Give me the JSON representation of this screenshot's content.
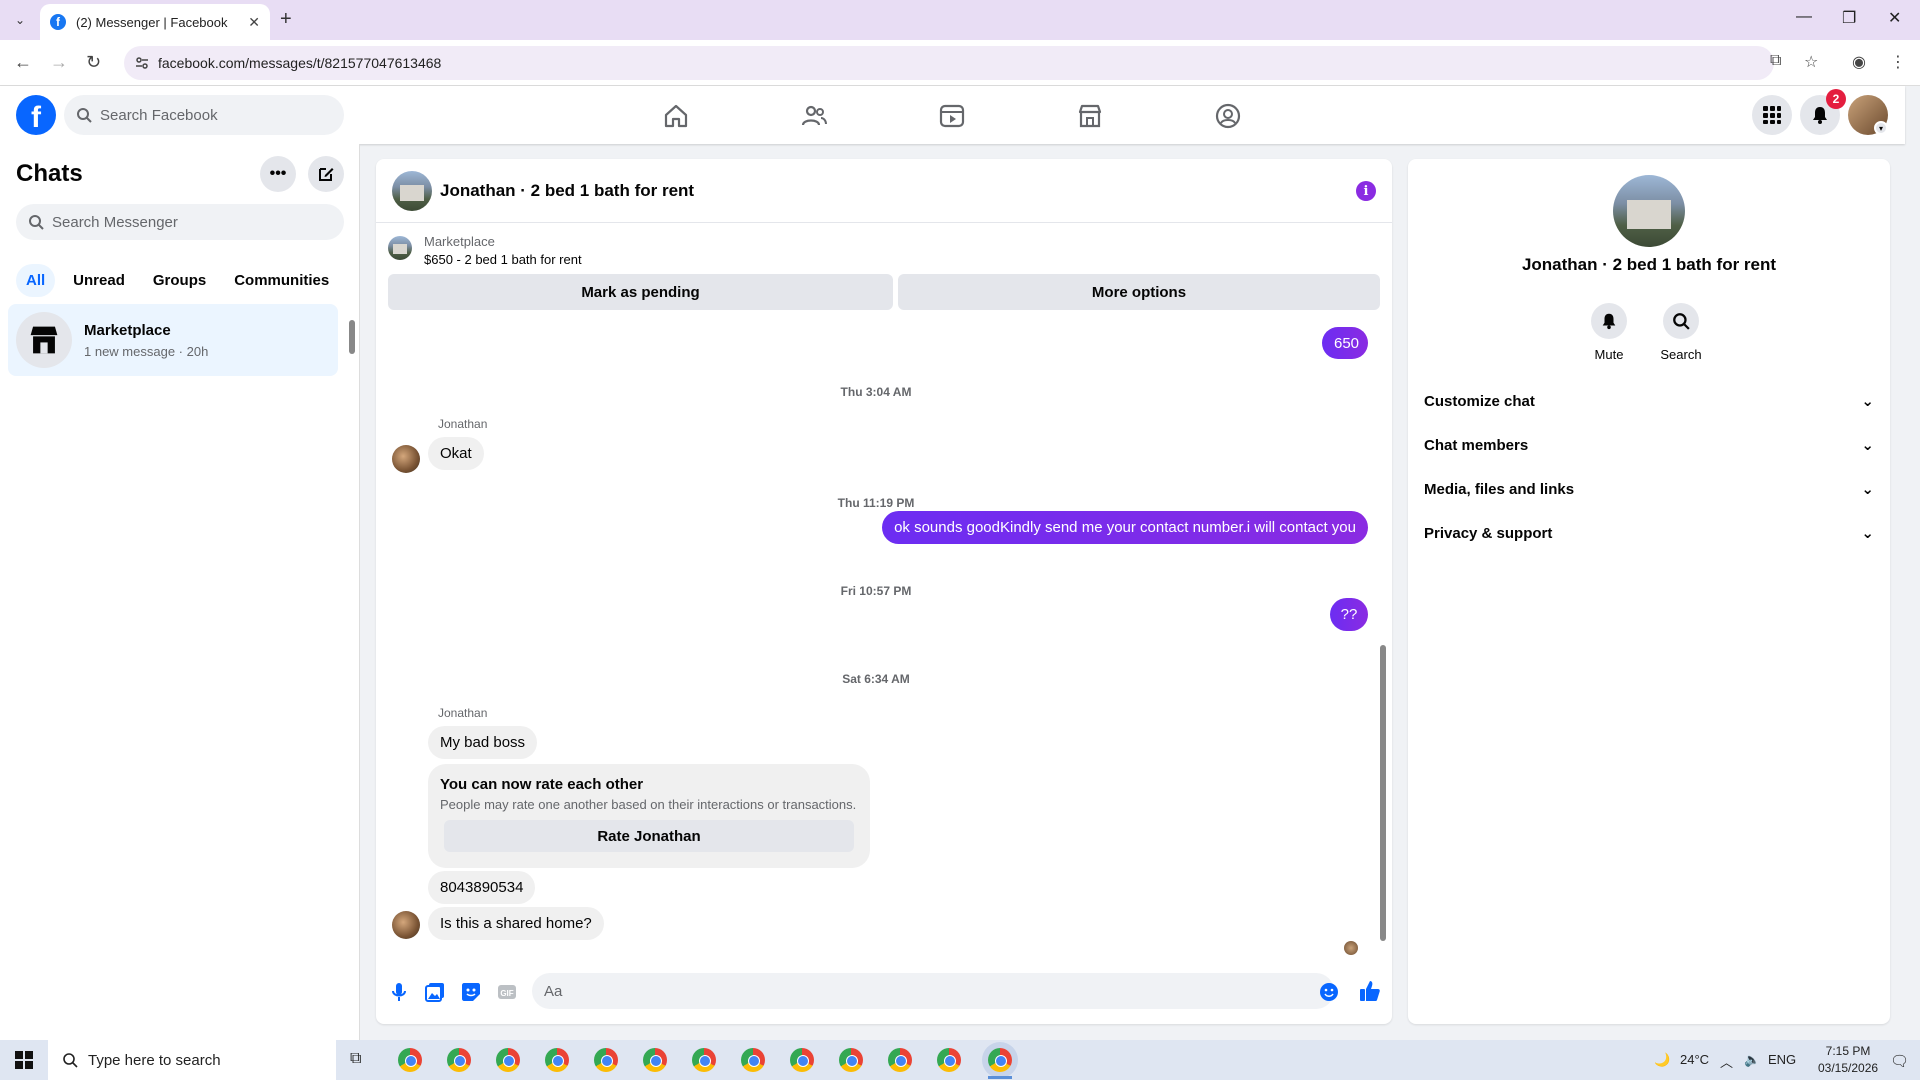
{
  "browser": {
    "tab_title": "(2) Messenger | Facebook",
    "url": "facebook.com/messages/t/821577047613468"
  },
  "fbnav": {
    "search_placeholder": "Search Facebook",
    "notifications_count": "2"
  },
  "sidebar": {
    "title": "Chats",
    "search_placeholder": "Search Messenger",
    "filters": [
      "All",
      "Unread",
      "Groups",
      "Communities"
    ],
    "chats": [
      {
        "name": "Marketplace",
        "subtitle": "1 new message · 20h"
      }
    ]
  },
  "conversation": {
    "title": "Jonathan · 2 bed 1 bath for rent",
    "marketplace_label": "Marketplace",
    "listing": "$650 - 2 bed 1 bath for rent",
    "mark_pending_label": "Mark as pending",
    "more_options_label": "More options",
    "messages": {
      "m650": "650",
      "ts1": "Thu 3:04 AM",
      "sender1": "Jonathan",
      "okat": "Okat",
      "ts2": "Thu 11:19 PM",
      "out_contact": "ok sounds goodKindly send me your contact number.i will contact you",
      "ts3": "Fri 10:57 PM",
      "out_qq": "??",
      "ts4": "Sat 6:34 AM",
      "sender2": "Jonathan",
      "badboss": "My bad boss",
      "rate_title": "You can now rate each other",
      "rate_desc": "People may rate one another based on their interactions or transactions.",
      "rate_button": "Rate Jonathan",
      "phone": "8043890534",
      "shared": "Is this a shared home?"
    },
    "composer_placeholder": "Aa"
  },
  "details": {
    "name": "Jonathan · 2 bed 1 bath for rent",
    "mute_label": "Mute",
    "search_label": "Search",
    "sections": [
      "Customize chat",
      "Chat members",
      "Media, files and links",
      "Privacy & support"
    ]
  },
  "taskbar": {
    "search_placeholder": "Type here to search",
    "weather": "24°C",
    "lang": "ENG",
    "time": "7:15 PM",
    "date": "03/15/2026"
  }
}
